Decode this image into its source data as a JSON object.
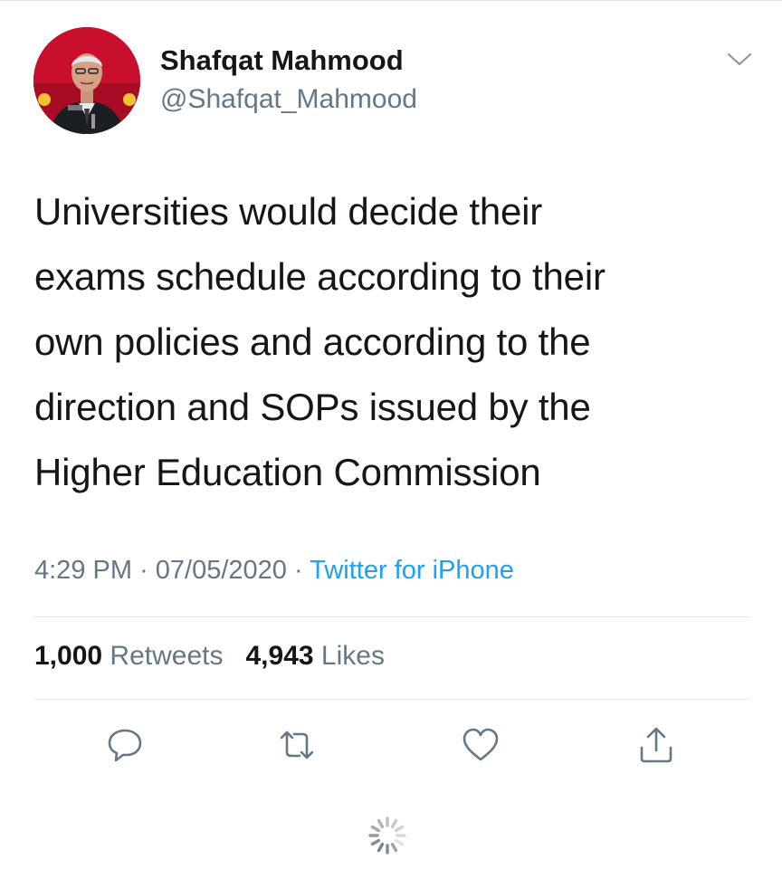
{
  "tweet": {
    "author": {
      "display_name": "Shafqat Mahmood",
      "handle": "@Shafqat_Mahmood"
    },
    "text_lines": [
      "Universities would decide their",
      "exams schedule according to their",
      "own policies and according to the",
      "direction and SOPs issued by the",
      "Higher Education Commission"
    ],
    "time": "4:29 PM",
    "date": "07/05/2020",
    "separator": "·",
    "source": "Twitter for iPhone",
    "stats": {
      "retweets_count": "1,000",
      "retweets_label": "Retweets",
      "likes_count": "4,943",
      "likes_label": "Likes"
    }
  },
  "icons": {
    "menu": "chevron-down-icon",
    "reply": "reply-icon",
    "retweet": "retweet-icon",
    "like": "heart-icon",
    "share": "share-icon",
    "loading": "loading-spinner-icon"
  },
  "colors": {
    "text": "#14171a",
    "secondary": "#657786",
    "link": "#1da1f2",
    "divider": "#e1e8ed",
    "avatar_bg": "#c8102e"
  }
}
